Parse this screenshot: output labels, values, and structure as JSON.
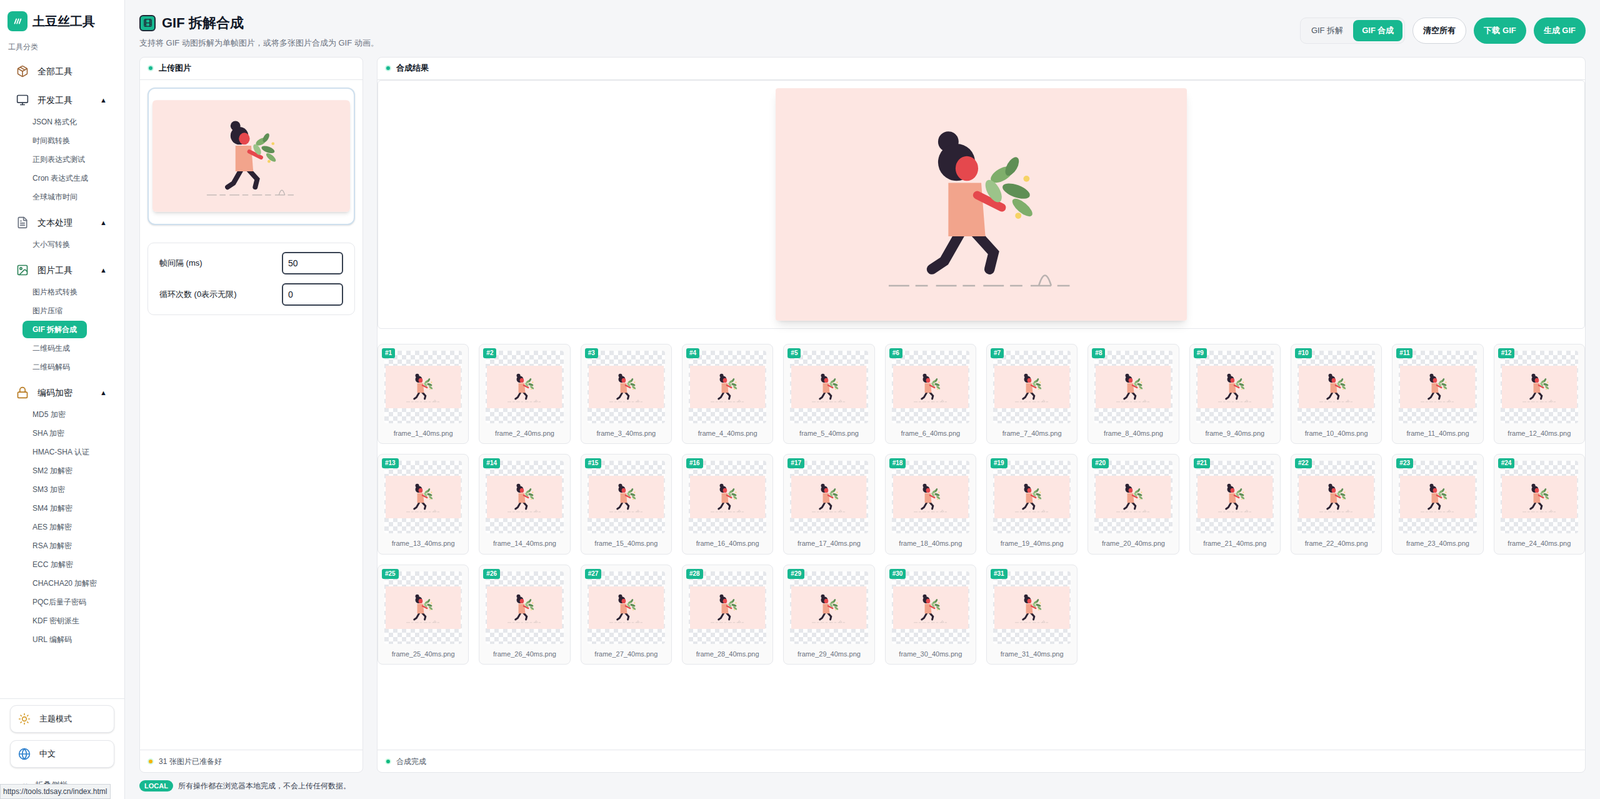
{
  "app": {
    "logo_text": "土豆丝工具"
  },
  "sidebar": {
    "section_label": "工具分类",
    "groups": [
      {
        "label": "全部工具",
        "items": []
      },
      {
        "label": "开发工具",
        "toggle": "▲",
        "expanded": true,
        "items": [
          {
            "label": "JSON 格式化",
            "selected": false
          },
          {
            "label": "时间戳转换",
            "selected": false
          },
          {
            "label": "正则表达式测试",
            "selected": false
          },
          {
            "label": "Cron 表达式生成",
            "selected": false
          },
          {
            "label": "全球城市时间",
            "selected": false
          }
        ]
      },
      {
        "label": "文本处理",
        "toggle": "▲",
        "expanded": true,
        "items": [
          {
            "label": "大小写转换",
            "selected": false
          }
        ]
      },
      {
        "label": "图片工具",
        "toggle": "▲",
        "expanded": true,
        "items": [
          {
            "label": "图片格式转换",
            "selected": false
          },
          {
            "label": "图片压缩",
            "selected": false
          },
          {
            "label": "GIF 拆解合成",
            "selected": true
          },
          {
            "label": "二维码生成",
            "selected": false
          },
          {
            "label": "二维码解码",
            "selected": false
          }
        ]
      },
      {
        "label": "编码加密",
        "toggle": "▲",
        "expanded": true,
        "items": [
          {
            "label": "MD5 加密",
            "selected": false
          },
          {
            "label": "SHA 加密",
            "selected": false
          },
          {
            "label": "HMAC-SHA 认证",
            "selected": false
          },
          {
            "label": "SM2 加解密",
            "selected": false
          },
          {
            "label": "SM3 加密",
            "selected": false
          },
          {
            "label": "SM4 加解密",
            "selected": false
          },
          {
            "label": "AES 加解密",
            "selected": false
          },
          {
            "label": "RSA 加解密",
            "selected": false
          },
          {
            "label": "ECC 加解密",
            "selected": false
          },
          {
            "label": "CHACHA20 加解密",
            "selected": false
          },
          {
            "label": "PQC后量子密码",
            "selected": false
          },
          {
            "label": "KDF 密钥派生",
            "selected": false
          },
          {
            "label": "URL 编解码",
            "selected": false
          }
        ]
      }
    ],
    "bottom_buttons": [
      {
        "label": "主题模式"
      },
      {
        "label": "中文"
      }
    ],
    "collapse": {
      "glyph": "«",
      "label": "折叠侧栏"
    }
  },
  "page": {
    "title": "GIF 拆解合成",
    "subtitle": "支持将 GIF 动图拆解为单帧图片，或将多张图片合成为 GIF 动画。"
  },
  "mode_tabs": [
    {
      "label": "GIF 拆解",
      "selected": false
    },
    {
      "label": "GIF 合成",
      "selected": true
    }
  ],
  "actions": [
    {
      "label": "清空所有",
      "kind": "outline"
    },
    {
      "label": "下载 GIF",
      "kind": "primary"
    },
    {
      "label": "生成 GIF",
      "kind": "primary"
    }
  ],
  "upload_panel": {
    "title": "上传图片",
    "settings": [
      {
        "label": "帧间隔 (ms)",
        "value": "50"
      },
      {
        "label": "循环次数 (0表示无限)",
        "value": "0"
      }
    ],
    "status": {
      "text": "31 张图片已准备好",
      "color": "#f5b301"
    }
  },
  "result_panel": {
    "title": "合成结果",
    "frames": [
      {
        "badge": "#1",
        "name": "frame_1_40ms.png"
      },
      {
        "badge": "#2",
        "name": "frame_2_40ms.png"
      },
      {
        "badge": "#3",
        "name": "frame_3_40ms.png"
      },
      {
        "badge": "#4",
        "name": "frame_4_40ms.png"
      },
      {
        "badge": "#5",
        "name": "frame_5_40ms.png"
      },
      {
        "badge": "#6",
        "name": "frame_6_40ms.png"
      },
      {
        "badge": "#7",
        "name": "frame_7_40ms.png"
      },
      {
        "badge": "#8",
        "name": "frame_8_40ms.png"
      },
      {
        "badge": "#9",
        "name": "frame_9_40ms.png"
      },
      {
        "badge": "#10",
        "name": "frame_10_40ms.png"
      },
      {
        "badge": "#11",
        "name": "frame_11_40ms.png"
      },
      {
        "badge": "#12",
        "name": "frame_12_40ms.png"
      },
      {
        "badge": "#13",
        "name": "frame_13_40ms.png"
      },
      {
        "badge": "#14",
        "name": "frame_14_40ms.png"
      },
      {
        "badge": "#15",
        "name": "frame_15_40ms.png"
      },
      {
        "badge": "#16",
        "name": "frame_16_40ms.png"
      },
      {
        "badge": "#17",
        "name": "frame_17_40ms.png"
      },
      {
        "badge": "#18",
        "name": "frame_18_40ms.png"
      },
      {
        "badge": "#19",
        "name": "frame_19_40ms.png"
      },
      {
        "badge": "#20",
        "name": "frame_20_40ms.png"
      },
      {
        "badge": "#21",
        "name": "frame_21_40ms.png"
      },
      {
        "badge": "#22",
        "name": "frame_22_40ms.png"
      },
      {
        "badge": "#23",
        "name": "frame_23_40ms.png"
      },
      {
        "badge": "#24",
        "name": "frame_24_40ms.png"
      },
      {
        "badge": "#25",
        "name": "frame_25_40ms.png"
      },
      {
        "badge": "#26",
        "name": "frame_26_40ms.png"
      },
      {
        "badge": "#27",
        "name": "frame_27_40ms.png"
      },
      {
        "badge": "#28",
        "name": "frame_28_40ms.png"
      },
      {
        "badge": "#29",
        "name": "frame_29_40ms.png"
      },
      {
        "badge": "#30",
        "name": "frame_30_40ms.png"
      },
      {
        "badge": "#31",
        "name": "frame_31_40ms.png"
      }
    ],
    "status": {
      "text": "合成完成",
      "color": "#10b981"
    }
  },
  "footer": {
    "badge": "LOCAL",
    "text": "所有操作都在浏览器本地完成，不会上传任何数据。"
  },
  "browser_status": "https://tools.tdsay.cn/index.html"
}
